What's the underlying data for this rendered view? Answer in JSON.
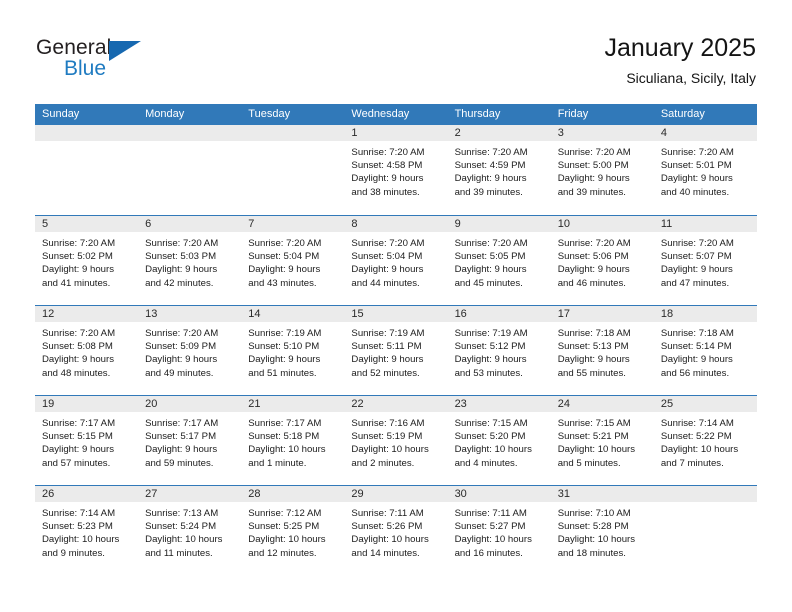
{
  "brand": {
    "name_part1": "General",
    "name_part2": "Blue",
    "triangle_color": "#1668b0",
    "blue_color": "#1f7bc1"
  },
  "header": {
    "title": "January 2025",
    "subtitle": "Siculiana, Sicily, Italy",
    "header_bg": "#3179b9",
    "day_band_bg": "#ebebeb"
  },
  "weekdays": [
    "Sunday",
    "Monday",
    "Tuesday",
    "Wednesday",
    "Thursday",
    "Friday",
    "Saturday"
  ],
  "weeks": [
    [
      {
        "day": "",
        "sunrise": "",
        "sunset": "",
        "daylight1": "",
        "daylight2": ""
      },
      {
        "day": "",
        "sunrise": "",
        "sunset": "",
        "daylight1": "",
        "daylight2": ""
      },
      {
        "day": "",
        "sunrise": "",
        "sunset": "",
        "daylight1": "",
        "daylight2": ""
      },
      {
        "day": "1",
        "sunrise": "Sunrise: 7:20 AM",
        "sunset": "Sunset: 4:58 PM",
        "daylight1": "Daylight: 9 hours",
        "daylight2": "and 38 minutes."
      },
      {
        "day": "2",
        "sunrise": "Sunrise: 7:20 AM",
        "sunset": "Sunset: 4:59 PM",
        "daylight1": "Daylight: 9 hours",
        "daylight2": "and 39 minutes."
      },
      {
        "day": "3",
        "sunrise": "Sunrise: 7:20 AM",
        "sunset": "Sunset: 5:00 PM",
        "daylight1": "Daylight: 9 hours",
        "daylight2": "and 39 minutes."
      },
      {
        "day": "4",
        "sunrise": "Sunrise: 7:20 AM",
        "sunset": "Sunset: 5:01 PM",
        "daylight1": "Daylight: 9 hours",
        "daylight2": "and 40 minutes."
      }
    ],
    [
      {
        "day": "5",
        "sunrise": "Sunrise: 7:20 AM",
        "sunset": "Sunset: 5:02 PM",
        "daylight1": "Daylight: 9 hours",
        "daylight2": "and 41 minutes."
      },
      {
        "day": "6",
        "sunrise": "Sunrise: 7:20 AM",
        "sunset": "Sunset: 5:03 PM",
        "daylight1": "Daylight: 9 hours",
        "daylight2": "and 42 minutes."
      },
      {
        "day": "7",
        "sunrise": "Sunrise: 7:20 AM",
        "sunset": "Sunset: 5:04 PM",
        "daylight1": "Daylight: 9 hours",
        "daylight2": "and 43 minutes."
      },
      {
        "day": "8",
        "sunrise": "Sunrise: 7:20 AM",
        "sunset": "Sunset: 5:04 PM",
        "daylight1": "Daylight: 9 hours",
        "daylight2": "and 44 minutes."
      },
      {
        "day": "9",
        "sunrise": "Sunrise: 7:20 AM",
        "sunset": "Sunset: 5:05 PM",
        "daylight1": "Daylight: 9 hours",
        "daylight2": "and 45 minutes."
      },
      {
        "day": "10",
        "sunrise": "Sunrise: 7:20 AM",
        "sunset": "Sunset: 5:06 PM",
        "daylight1": "Daylight: 9 hours",
        "daylight2": "and 46 minutes."
      },
      {
        "day": "11",
        "sunrise": "Sunrise: 7:20 AM",
        "sunset": "Sunset: 5:07 PM",
        "daylight1": "Daylight: 9 hours",
        "daylight2": "and 47 minutes."
      }
    ],
    [
      {
        "day": "12",
        "sunrise": "Sunrise: 7:20 AM",
        "sunset": "Sunset: 5:08 PM",
        "daylight1": "Daylight: 9 hours",
        "daylight2": "and 48 minutes."
      },
      {
        "day": "13",
        "sunrise": "Sunrise: 7:20 AM",
        "sunset": "Sunset: 5:09 PM",
        "daylight1": "Daylight: 9 hours",
        "daylight2": "and 49 minutes."
      },
      {
        "day": "14",
        "sunrise": "Sunrise: 7:19 AM",
        "sunset": "Sunset: 5:10 PM",
        "daylight1": "Daylight: 9 hours",
        "daylight2": "and 51 minutes."
      },
      {
        "day": "15",
        "sunrise": "Sunrise: 7:19 AM",
        "sunset": "Sunset: 5:11 PM",
        "daylight1": "Daylight: 9 hours",
        "daylight2": "and 52 minutes."
      },
      {
        "day": "16",
        "sunrise": "Sunrise: 7:19 AM",
        "sunset": "Sunset: 5:12 PM",
        "daylight1": "Daylight: 9 hours",
        "daylight2": "and 53 minutes."
      },
      {
        "day": "17",
        "sunrise": "Sunrise: 7:18 AM",
        "sunset": "Sunset: 5:13 PM",
        "daylight1": "Daylight: 9 hours",
        "daylight2": "and 55 minutes."
      },
      {
        "day": "18",
        "sunrise": "Sunrise: 7:18 AM",
        "sunset": "Sunset: 5:14 PM",
        "daylight1": "Daylight: 9 hours",
        "daylight2": "and 56 minutes."
      }
    ],
    [
      {
        "day": "19",
        "sunrise": "Sunrise: 7:17 AM",
        "sunset": "Sunset: 5:15 PM",
        "daylight1": "Daylight: 9 hours",
        "daylight2": "and 57 minutes."
      },
      {
        "day": "20",
        "sunrise": "Sunrise: 7:17 AM",
        "sunset": "Sunset: 5:17 PM",
        "daylight1": "Daylight: 9 hours",
        "daylight2": "and 59 minutes."
      },
      {
        "day": "21",
        "sunrise": "Sunrise: 7:17 AM",
        "sunset": "Sunset: 5:18 PM",
        "daylight1": "Daylight: 10 hours",
        "daylight2": "and 1 minute."
      },
      {
        "day": "22",
        "sunrise": "Sunrise: 7:16 AM",
        "sunset": "Sunset: 5:19 PM",
        "daylight1": "Daylight: 10 hours",
        "daylight2": "and 2 minutes."
      },
      {
        "day": "23",
        "sunrise": "Sunrise: 7:15 AM",
        "sunset": "Sunset: 5:20 PM",
        "daylight1": "Daylight: 10 hours",
        "daylight2": "and 4 minutes."
      },
      {
        "day": "24",
        "sunrise": "Sunrise: 7:15 AM",
        "sunset": "Sunset: 5:21 PM",
        "daylight1": "Daylight: 10 hours",
        "daylight2": "and 5 minutes."
      },
      {
        "day": "25",
        "sunrise": "Sunrise: 7:14 AM",
        "sunset": "Sunset: 5:22 PM",
        "daylight1": "Daylight: 10 hours",
        "daylight2": "and 7 minutes."
      }
    ],
    [
      {
        "day": "26",
        "sunrise": "Sunrise: 7:14 AM",
        "sunset": "Sunset: 5:23 PM",
        "daylight1": "Daylight: 10 hours",
        "daylight2": "and 9 minutes."
      },
      {
        "day": "27",
        "sunrise": "Sunrise: 7:13 AM",
        "sunset": "Sunset: 5:24 PM",
        "daylight1": "Daylight: 10 hours",
        "daylight2": "and 11 minutes."
      },
      {
        "day": "28",
        "sunrise": "Sunrise: 7:12 AM",
        "sunset": "Sunset: 5:25 PM",
        "daylight1": "Daylight: 10 hours",
        "daylight2": "and 12 minutes."
      },
      {
        "day": "29",
        "sunrise": "Sunrise: 7:11 AM",
        "sunset": "Sunset: 5:26 PM",
        "daylight1": "Daylight: 10 hours",
        "daylight2": "and 14 minutes."
      },
      {
        "day": "30",
        "sunrise": "Sunrise: 7:11 AM",
        "sunset": "Sunset: 5:27 PM",
        "daylight1": "Daylight: 10 hours",
        "daylight2": "and 16 minutes."
      },
      {
        "day": "31",
        "sunrise": "Sunrise: 7:10 AM",
        "sunset": "Sunset: 5:28 PM",
        "daylight1": "Daylight: 10 hours",
        "daylight2": "and 18 minutes."
      },
      {
        "day": "",
        "sunrise": "",
        "sunset": "",
        "daylight1": "",
        "daylight2": ""
      }
    ]
  ]
}
